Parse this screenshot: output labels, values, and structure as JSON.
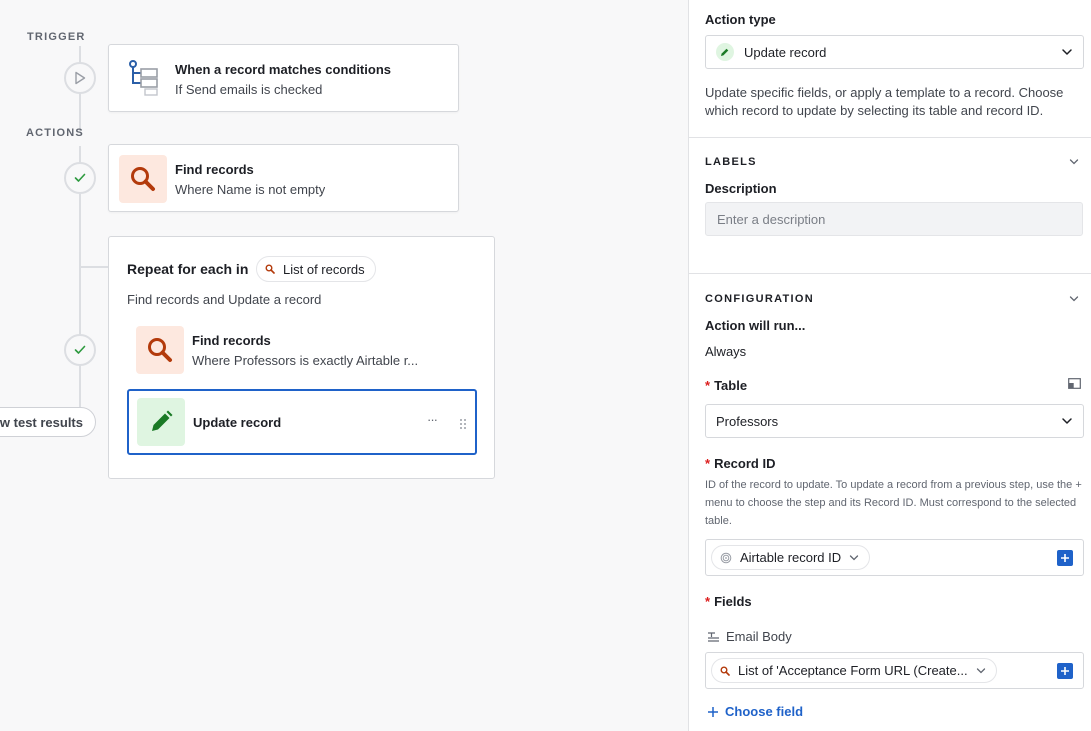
{
  "canvas": {
    "trigger_label": "TRIGGER",
    "actions_label": "ACTIONS",
    "trigger_card": {
      "title": "When a record matches conditions",
      "subtitle": "If Send emails is checked"
    },
    "find_card": {
      "title": "Find records",
      "subtitle": "Where Name is not empty"
    },
    "repeat": {
      "title": "Repeat for each in",
      "pill_label": "List of records",
      "description": "Find records and Update a record",
      "inner_find": {
        "title": "Find records",
        "subtitle": "Where Professors is exactly Airtable r..."
      },
      "inner_update": {
        "title": "Update record",
        "more": "···"
      }
    },
    "test_results_button": "w test results"
  },
  "panel": {
    "action_type_label": "Action type",
    "action_type_value": "Update record",
    "action_help": "Update specific fields, or apply a template to a record. Choose which record to update by selecting its table and record ID.",
    "labels_section": "LABELS",
    "description_label": "Description",
    "description_placeholder": "Enter a description",
    "configuration_section": "CONFIGURATION",
    "action_will_run_label": "Action will run...",
    "action_will_run_value": "Always",
    "table_label": "Table",
    "table_value": "Professors",
    "record_id_label": "Record ID",
    "record_id_help": "ID of the record to update. To update a record from a previous step, use the + menu to choose the step and its Record ID. Must correspond to the selected table.",
    "record_id_token": "Airtable record ID",
    "fields_label": "Fields",
    "email_body_label": "Email Body",
    "email_body_token": "List of 'Acceptance Form URL (Create...",
    "choose_field": "Choose field",
    "required_mark": "*"
  },
  "colors": {
    "accent_blue": "#1f62c9",
    "find_icon_bg": "#fde8df",
    "find_icon_fg": "#b33a0b",
    "update_icon_bg": "#dff5e1",
    "update_icon_fg": "#1a7a25",
    "required_red": "#dc1d1d"
  }
}
